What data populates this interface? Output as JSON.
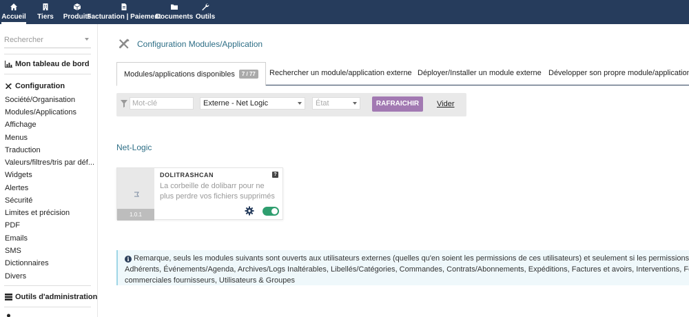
{
  "topnav": [
    {
      "label": "Accueil",
      "icon": "home-icon",
      "active": true
    },
    {
      "label": "Tiers",
      "icon": "building-icon"
    },
    {
      "label": "Produits",
      "icon": "cube-icon"
    },
    {
      "label": "Facturation | Paiement",
      "icon": "file-invoice-icon"
    },
    {
      "label": "Documents",
      "icon": "folder-icon"
    },
    {
      "label": "Outils",
      "icon": "wrench-icon"
    }
  ],
  "sidebar": {
    "search_placeholder": "Rechercher",
    "dashboard": "Mon tableau de bord",
    "configuration": "Configuration",
    "items": [
      "Société/Organisation",
      "Modules/Applications",
      "Affichage",
      "Menus",
      "Traduction",
      "Valeurs/filtres/tris par déf...",
      "Widgets",
      "Alertes",
      "Sécurité",
      "Limites et précision",
      "PDF",
      "Emails",
      "SMS",
      "Dictionnaires",
      "Divers"
    ],
    "admin_tools": "Outils d'administration"
  },
  "page": {
    "title": "Configuration Modules/Application"
  },
  "tabs": [
    {
      "label": "Modules/applications disponibles",
      "badge": "7 / 77",
      "active": true
    },
    {
      "label": "Rechercher un module/application externe"
    },
    {
      "label": "Déployer/Installer un module externe"
    },
    {
      "label": "Développer son propre module/application"
    }
  ],
  "filters": {
    "keyword_placeholder": "Mot-clé",
    "origin_value": "Externe - Net Logic",
    "state_placeholder": "État",
    "refresh_label": "RAFRAICHIR",
    "clear_label": "Vider"
  },
  "section_title": "Net-Logic",
  "module_card": {
    "name": "DOLITRASHCAN",
    "description": "La corbeille de dolibarr pour ne plus perdre vos fichiers supprimés",
    "version": "1.0.1",
    "help": "?",
    "enabled": true
  },
  "info": {
    "line1": "Remarque, seuls les modules suivants sont ouverts aux utilisateurs externes (quelles qu'en soient les permissions de ces utilisateurs) et seulement si les permissions leur ont été d",
    "line2": "Adhérents, Événements/Agenda, Archives/Logs Inaltérables, Libellés/Catégories, Commandes, Contrats/Abonnements, Expéditions, Factures et avoirs, Interventions, Fournisseurs, P",
    "line3": "commerciales fournisseurs, Utilisateurs & Groupes"
  },
  "colors": {
    "topbar": "#263c5c",
    "accent": "#a279b2",
    "link_title": "#2d6e86",
    "toggle_on": "#2f9e6f",
    "info_bg": "#eff8fb"
  }
}
